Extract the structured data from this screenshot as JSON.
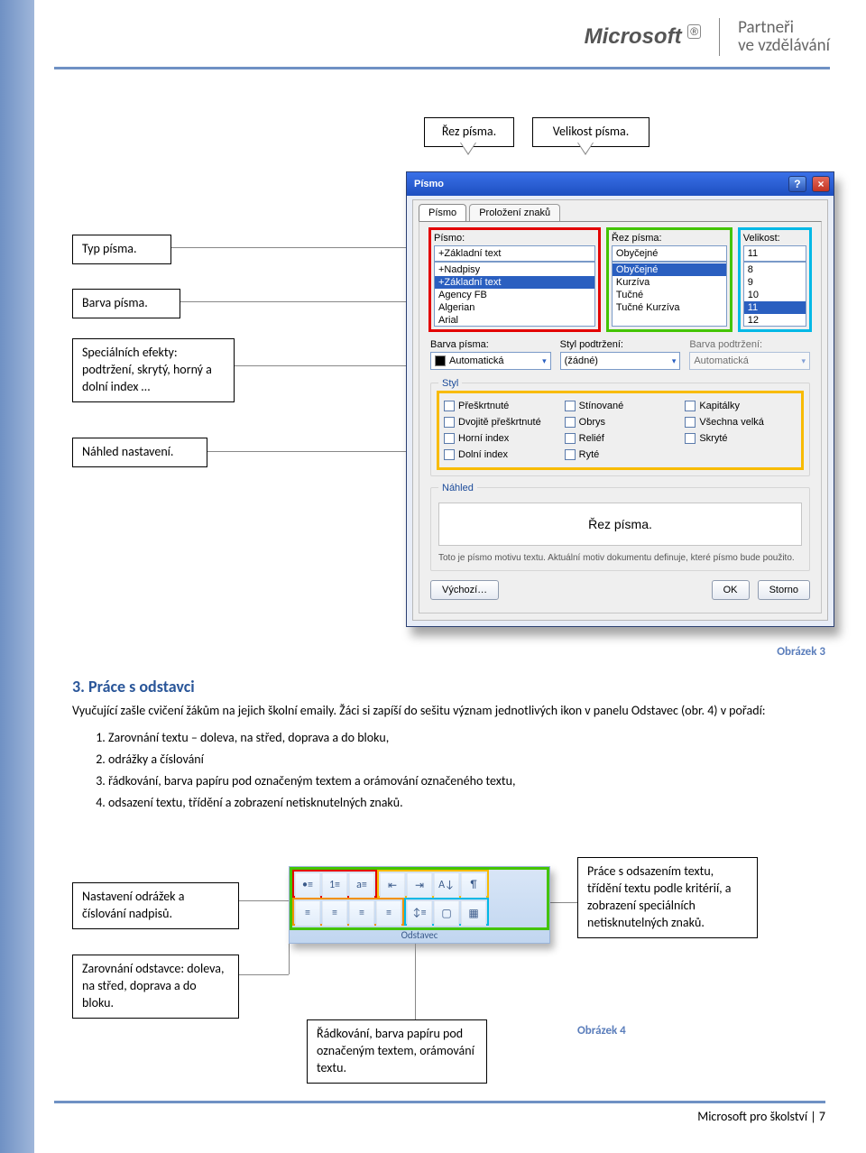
{
  "header": {
    "brand": "Microsoft",
    "tagline_l1": "Partneři",
    "tagline_l2": "ve vzdělávání"
  },
  "callouts_top": {
    "rez": "Řez písma.",
    "velikost": "Velikost písma.",
    "typ": "Typ písma.",
    "barva": "Barva písma.",
    "efekty": "Speciálních efekty: podtržení, skrytý, horný a dolní index …",
    "nahled": "Náhled nastavení."
  },
  "dialog": {
    "title": "Písmo",
    "tab1": "Písmo",
    "tab2": "Proložení znaků",
    "lbl_pismo": "Písmo:",
    "lbl_rez": "Řez písma:",
    "lbl_velikost": "Velikost:",
    "val_pismo": "+Základní text",
    "val_rez": "Obyčejné",
    "val_velikost": "11",
    "list_fonts": [
      "+Nadpisy",
      "+Základní text",
      "Agency FB",
      "Algerian",
      "Arial"
    ],
    "list_styles": [
      "Obyčejné",
      "Kurzíva",
      "Tučné",
      "Tučné Kurzíva"
    ],
    "list_sizes": [
      "8",
      "9",
      "10",
      "11",
      "12"
    ],
    "lbl_barva": "Barva písma:",
    "val_barva": "Automatická",
    "lbl_styl_pod": "Styl podtržení:",
    "val_styl_pod": "(žádné)",
    "lbl_barva_pod": "Barva podtržení:",
    "val_barva_pod": "Automatická",
    "group_styl": "Styl",
    "chk": [
      "Přeškrtnuté",
      "Dvojitě přeškrtnuté",
      "Horní index",
      "Dolní index",
      "Stínované",
      "Obrys",
      "Reliéf",
      "Ryté",
      "Kapitálky",
      "Všechna velká",
      "Skryté"
    ],
    "group_nahled": "Náhled",
    "preview": "Řez písma.",
    "note": "Toto je písmo motivu textu. Aktuální motiv dokumentu definuje, které písmo bude použito.",
    "btn_vychozi": "Výchozí…",
    "btn_ok": "OK",
    "btn_storno": "Storno"
  },
  "fig3": "Obrázek 3",
  "section": {
    "heading": "3. Práce s odstavci",
    "p1": "Vyučující zašle cvičení žákům na jejich školní emaily. Žáci si zapíší do sešitu význam jednotlivých ikon v panelu Odstavec (obr. 4) v pořadí:",
    "items": [
      "Zarovnání textu – doleva, na střed, doprava a do bloku,",
      "odrážky a číslování",
      "řádkování, barva papíru pod označeným textem a orámování označeného textu,",
      "odsazení textu, třídění a zobrazení netisknutelných znaků."
    ]
  },
  "callouts_bottom": {
    "odrazky": "Nastavení odrážek a číslování nadpisů.",
    "zarovnani": "Zarovnání odstavce: doleva, na střed, doprava a do bloku.",
    "radkovani": "Řádkování, barva papíru pod označeným textem, orámování textu.",
    "odsazeni": "Práce s odsazením textu, třídění textu podle kritérií, a zobrazení speciálních netisknutelných znaků."
  },
  "paragraph_group_title": "Odstavec",
  "fig4": "Obrázek 4",
  "footer": {
    "text": "Microsoft pro školství",
    "page": "7"
  }
}
